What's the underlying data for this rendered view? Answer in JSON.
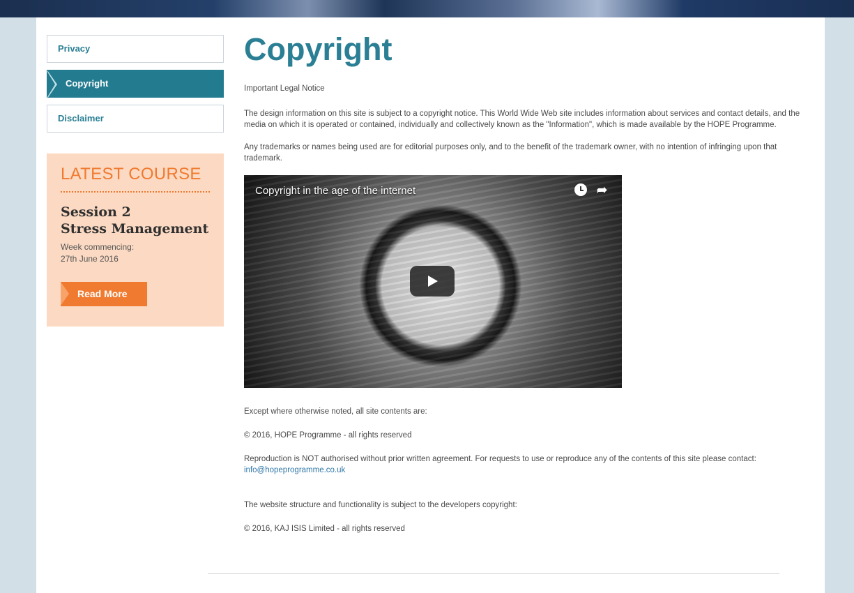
{
  "sidebar": {
    "items": [
      {
        "label": "Privacy",
        "active": false
      },
      {
        "label": "Copyright",
        "active": true
      },
      {
        "label": "Disclaimer",
        "active": false
      }
    ]
  },
  "course": {
    "heading": "LATEST COURSE",
    "title_line1": "Session 2",
    "title_line2": "Stress Management",
    "meta_line1": "Week commencing:",
    "meta_line2": "27th June 2016",
    "button_label": "Read More"
  },
  "main": {
    "title": "Copyright",
    "notice": "Important Legal Notice",
    "info": "The design information on this site is subject to a copyright notice. This World Wide Web site includes information about services and contact details, and the media on which it is operated or contained, individually and collectively known as the \"Information\", which is made available by the HOPE Programme.",
    "trademark": "Any trademarks or names being used are for editorial purposes only, and to the benefit of the trademark owner, with no intention of infringing upon that trademark.",
    "video": {
      "title": "Copyright in the age of the internet",
      "icons": [
        "clock-icon",
        "share-icon",
        "play-icon"
      ]
    },
    "except": "Except where otherwise noted, all site contents are:",
    "copyright_hope": "© 2016, HOPE Programme - all rights reserved",
    "reproduction": "Reproduction is NOT authorised without prior written agreement. For requests to use or reproduce any of the contents of this site please contact:",
    "contact_email": "info@hopeprogramme.co.uk",
    "developer": "The website structure and functionality is subject to the developers copyright:",
    "copyright_kaj": "© 2016, KAJ ISIS Limited - all rights reserved"
  },
  "colors": {
    "accent_teal": "#2a7f94",
    "accent_orange": "#f07a2f",
    "course_bg": "#fbd9c2",
    "page_bg": "#d3dfe6"
  }
}
